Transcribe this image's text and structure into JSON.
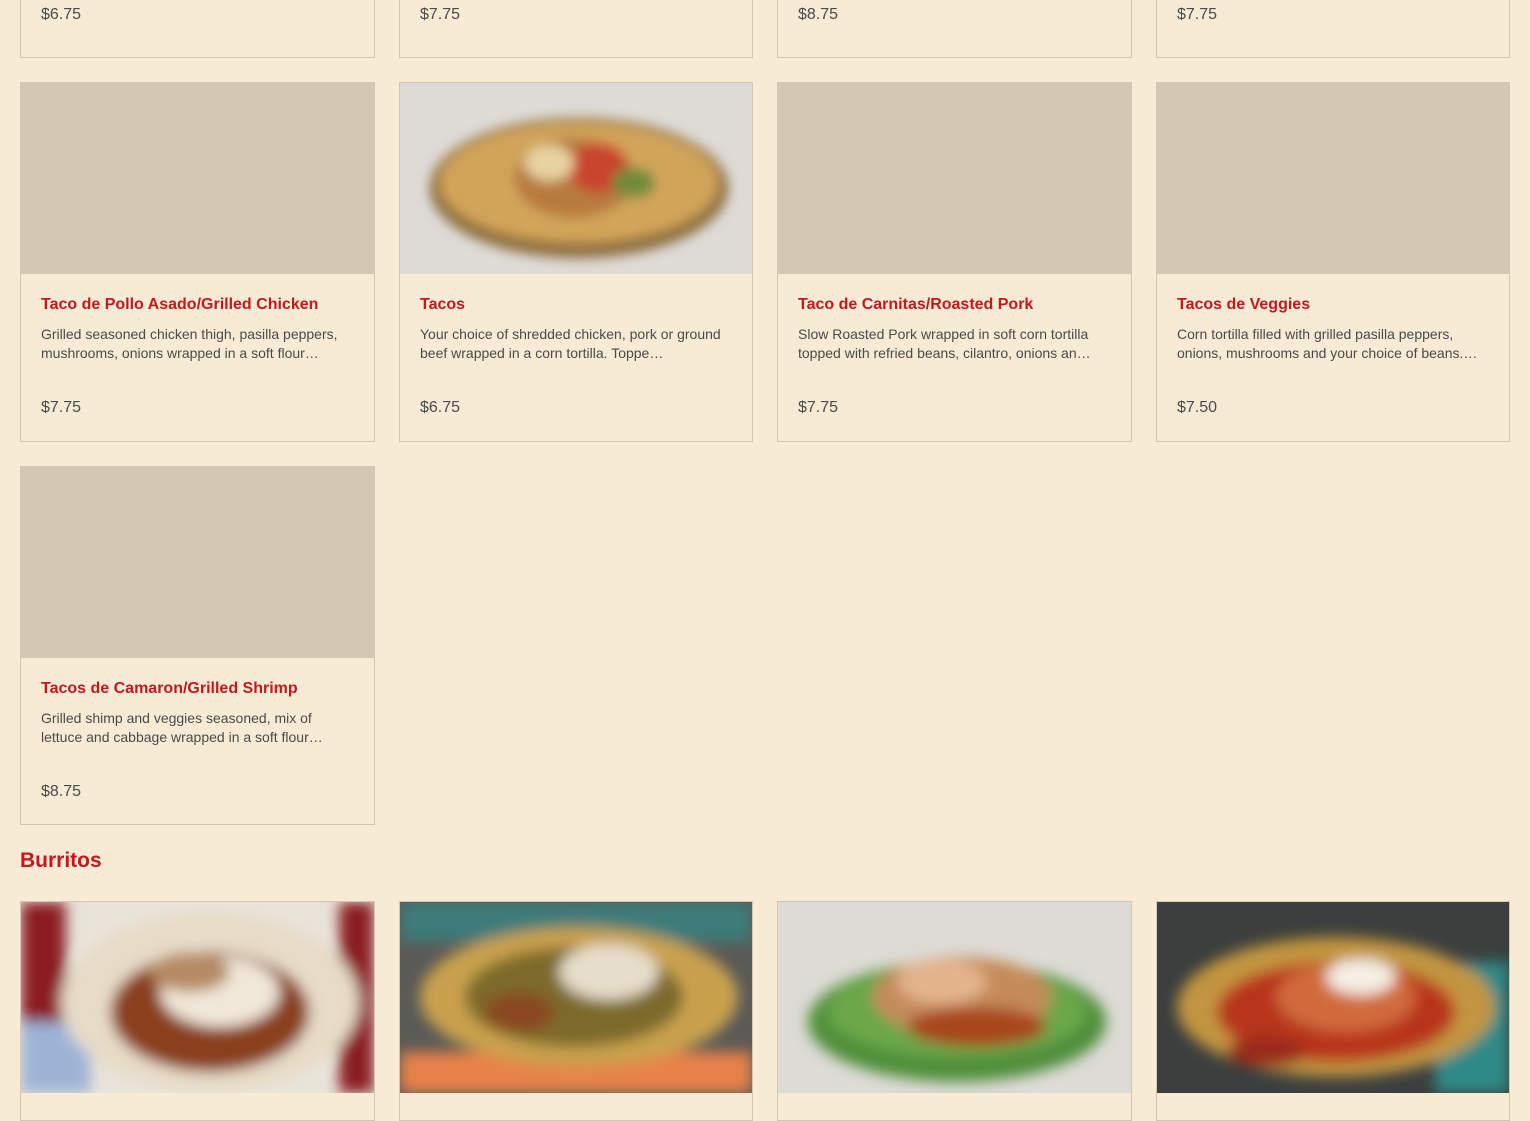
{
  "top_row_prices": [
    "$6.75",
    "$7.75",
    "$8.75",
    "$7.75"
  ],
  "tacos": [
    {
      "title": "Taco de Pollo Asado/Grilled Chicken",
      "description": "Grilled seasoned chicken thigh, pasilla peppers, mushrooms, onions wrapped in a soft flour…",
      "price": "$7.75"
    },
    {
      "title": "Tacos",
      "description": "Your choice of shredded chicken, pork or ground beef wrapped in a corn tortilla. Toppe…",
      "price": "$6.75"
    },
    {
      "title": "Taco de Carnitas/Roasted Pork",
      "description": "Slow Roasted Pork wrapped in soft corn tortilla topped with refried beans, cilantro, onions an…",
      "price": "$7.75"
    },
    {
      "title": "Tacos de Veggies",
      "description": "Corn tortilla filled with grilled pasilla peppers, onions, mushrooms and your choice of beans.…",
      "price": "$7.50"
    },
    {
      "title": "Tacos de Camaron/Grilled Shrimp",
      "description": "Grilled shimp and veggies seasoned, mix of lettuce and cabbage wrapped in a soft flour…",
      "price": "$8.75"
    }
  ],
  "burritos_section": {
    "title": "Burritos"
  },
  "colors": {
    "background": "#f7ebd6",
    "accent": "#c8161d",
    "placeholder": "#d4c8b4",
    "border": "#d3c6b0"
  }
}
